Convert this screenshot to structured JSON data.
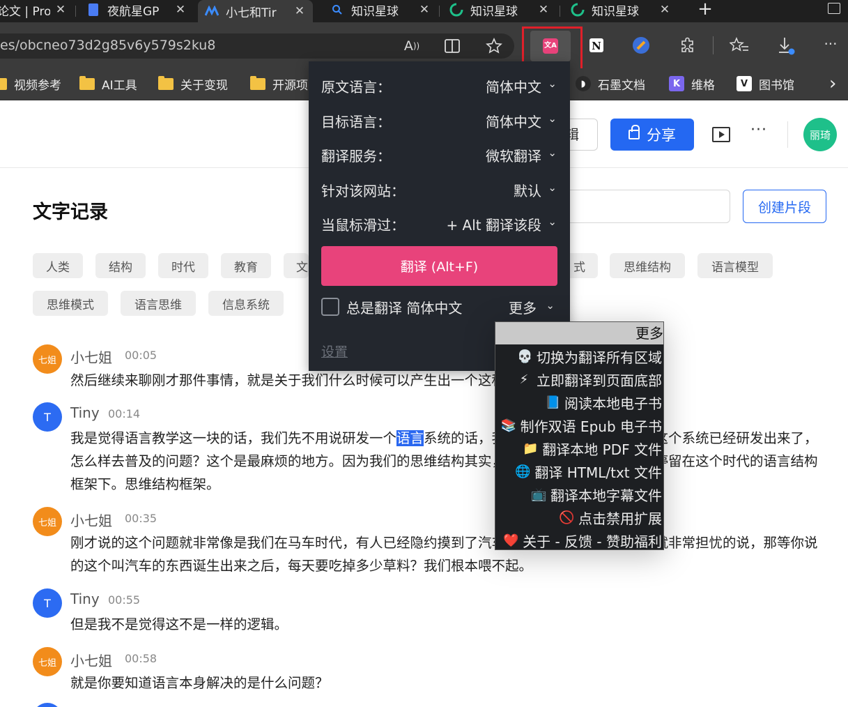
{
  "tabs": [
    {
      "title": "论文 | Pro",
      "icon": "page-icon"
    },
    {
      "title": "夜航星GP",
      "icon": "doc-icon"
    },
    {
      "title": "小七和Tir",
      "icon": "wave-icon",
      "active": true
    },
    {
      "title": "知识星球",
      "icon": "search-icon"
    },
    {
      "title": "知识星球",
      "icon": "loading-icon"
    },
    {
      "title": "知识星球",
      "icon": "loading-icon"
    }
  ],
  "tab_close": "✕",
  "new_tab": "+",
  "address": {
    "url": "es/obcneo73d2g85v6y579s2ku8"
  },
  "bookmarks": [
    {
      "label": "视频参考",
      "icon": "folder-icon"
    },
    {
      "label": "AI工具",
      "icon": "folder-icon"
    },
    {
      "label": "关于变现",
      "icon": "folder-icon"
    },
    {
      "label": "开源项",
      "icon": "folder-icon"
    },
    {
      "label": "石墨文档",
      "icon": "shimo-icon"
    },
    {
      "label": "维格",
      "icon": "vika-icon"
    },
    {
      "label": "图书馆",
      "icon": "library-icon"
    }
  ],
  "bookmarks_more": "›",
  "header": {
    "edit_label": "辑",
    "share_label": "分享",
    "user_avatar": "丽琦",
    "more": "···"
  },
  "section": {
    "title": "文字记录",
    "create_label": "创建片段"
  },
  "tags_row1": [
    "人类",
    "结构",
    "时代",
    "教育",
    "文",
    "式",
    "思维结构",
    "语言模型"
  ],
  "tags_row2": [
    "思维模式",
    "语言思维",
    "信息系统"
  ],
  "messages": [
    {
      "name": "小七姐",
      "avatar": "七姐",
      "time": "00:05",
      "text": "然后继续来聊刚才那件事情，就是关于我们什么时候可以产生出一个这种系统。"
    },
    {
      "name": "Tiny",
      "avatar": "T",
      "time": "00:14",
      "text_before": "我是觉得语言教学这一块的话，我们先不用说研发一个",
      "text_selected": "语言",
      "text_after": "系统的话，我们现在的问题就是说如果这个系统已经研发出来了，怎么样去普及的问题？这个是最麻烦的地方。因为我们的思维结构其实，我们这个时代的人，一直停留在这个时代的语言结构框架下。思维结构框架。"
    },
    {
      "name": "小七姐",
      "avatar": "七姐",
      "time": "00:35",
      "text": "刚才说的这个问题就非常像是我们在马车时代，有人已经隐约摸到了汽车这种产品的时候，其他人就非常担忧的说，那等你说的这个叫汽车的东西诞生出来之后，每天要吃掉多少草料？我们根本喂不起。"
    },
    {
      "name": "Tiny",
      "avatar": "T",
      "time": "00:55",
      "text": "但是我不是觉得这不是一样的逻辑。"
    },
    {
      "name": "小七姐",
      "avatar": "七姐",
      "time": "00:58",
      "text": "就是你要知道语言本身解决的是什么问题？"
    }
  ],
  "translate_popup": {
    "rows": [
      {
        "label": "原文语言：",
        "value": "简体中文"
      },
      {
        "label": "目标语言：",
        "value": "简体中文"
      },
      {
        "label": "翻译服务：",
        "value": "微软翻译"
      },
      {
        "label": "针对该网站：",
        "value": "默认"
      },
      {
        "label": "当鼠标滑过：",
        "value": "+ Alt 翻译该段"
      }
    ],
    "translate_button": "翻译 (Alt+F)",
    "always_translate": "总是翻译 简体中文",
    "more": "更多",
    "settings": "设置"
  },
  "more_menu": {
    "header": "更多",
    "items": [
      {
        "icon": "💀",
        "label": "切换为翻译所有区域"
      },
      {
        "icon": "⚡",
        "label": "立即翻译到页面底部"
      },
      {
        "icon": "📘",
        "label": "阅读本地电子书"
      },
      {
        "icon": "📚",
        "label": "制作双语 Epub 电子书"
      },
      {
        "icon": "📁",
        "label": "翻译本地 PDF 文件"
      },
      {
        "icon": "🌐",
        "label": "翻译 HTML/txt 文件"
      },
      {
        "icon": "📺",
        "label": "翻译本地字幕文件"
      },
      {
        "icon": "🚫",
        "label": "点击禁用扩展"
      },
      {
        "icon": "❤️",
        "label": "关于 - 反馈 - 赞助福利"
      }
    ]
  },
  "colors": {
    "accent_blue": "#2468f2",
    "translate_pink": "#e8437b",
    "highlight_red": "#e0202a",
    "orange_avatar": "#f28c1b",
    "green_avatar": "#1ec08a"
  }
}
